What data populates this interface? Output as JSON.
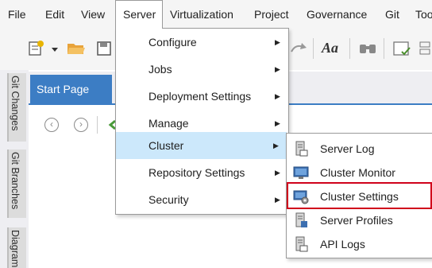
{
  "menubar": {
    "items": [
      {
        "label": "File"
      },
      {
        "label": "Edit"
      },
      {
        "label": "View"
      },
      {
        "label": "Server"
      },
      {
        "label": "Virtualization"
      },
      {
        "label": "Project"
      },
      {
        "label": "Governance"
      },
      {
        "label": "Git"
      },
      {
        "label": "Too"
      }
    ]
  },
  "toolbar": {
    "font_button_label": "Aa"
  },
  "left_rail": {
    "tabs": [
      "Git Changes",
      "Git Branches",
      "Diagram"
    ]
  },
  "document": {
    "start_tab_label": "Start Page"
  },
  "server_menu": {
    "items": [
      {
        "label": "Configure",
        "has_submenu": true
      },
      {
        "label": "Jobs",
        "has_submenu": true
      },
      {
        "label": "Deployment Settings",
        "has_submenu": true
      },
      {
        "label": "Manage",
        "has_submenu": true
      },
      {
        "label": "Cluster",
        "has_submenu": true,
        "highlighted": true
      },
      {
        "label": "Repository Settings",
        "has_submenu": true
      },
      {
        "label": "Security",
        "has_submenu": true
      }
    ]
  },
  "cluster_submenu": {
    "items": [
      {
        "label": "Server Log",
        "icon": "server-log-icon"
      },
      {
        "label": "Cluster Monitor",
        "icon": "cluster-monitor-icon"
      },
      {
        "label": "Cluster Settings",
        "icon": "cluster-settings-icon",
        "selected": true
      },
      {
        "label": "Server Profiles",
        "icon": "server-profiles-icon"
      },
      {
        "label": "API Logs",
        "icon": "api-logs-icon"
      }
    ]
  },
  "colors": {
    "accent": "#3c7dc4",
    "highlight": "#cce8fb",
    "selection_outline": "#d0021b"
  }
}
